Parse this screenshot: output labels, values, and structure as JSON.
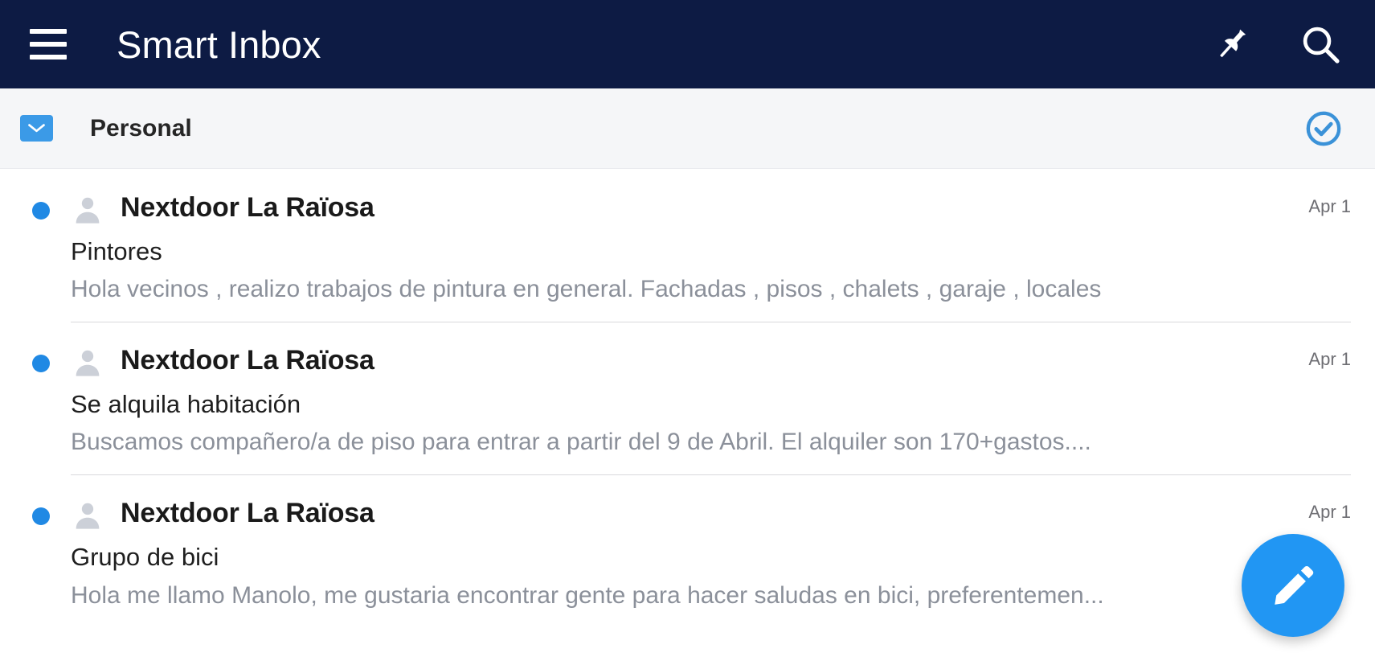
{
  "appbar": {
    "title": "Smart Inbox",
    "menu_icon": "hamburger-menu-icon",
    "pin_icon": "pin-icon",
    "search_icon": "search-icon",
    "background_color": "#0d1b44"
  },
  "account_bar": {
    "label": "Personal",
    "envelope_icon": "envelope-icon",
    "select_all_icon": "check-circle-icon",
    "accent_color": "#3b9ae7",
    "background_color": "#f5f6f8"
  },
  "messages": [
    {
      "unread": true,
      "avatar_icon": "person-avatar-icon",
      "sender": "Nextdoor La Raïosa",
      "date": "Apr 1",
      "subject": "Pintores",
      "preview": "Hola vecinos , realizo trabajos de pintura en general. Fachadas , pisos , chalets , garaje , locales"
    },
    {
      "unread": true,
      "avatar_icon": "person-avatar-icon",
      "sender": "Nextdoor La Raïosa",
      "date": "Apr 1",
      "subject": "Se alquila habitación",
      "preview": "Buscamos compañero/a de piso para entrar a partir del 9 de Abril. El alquiler son 170+gastos...."
    },
    {
      "unread": true,
      "avatar_icon": "person-avatar-icon",
      "sender": "Nextdoor La Raïosa",
      "date": "Apr 1",
      "subject": "Grupo de bici",
      "preview": "Hola me llamo Manolo, me gustaria encontrar gente para hacer saludas en bici, preferentemen..."
    }
  ],
  "compose_fab": {
    "icon": "pencil-icon",
    "color": "#2196f3"
  },
  "colors": {
    "unread_dot": "#2089e4",
    "sender_text": "#1a1a1a",
    "preview_text": "#8b909a",
    "date_text": "#6e6e73"
  }
}
